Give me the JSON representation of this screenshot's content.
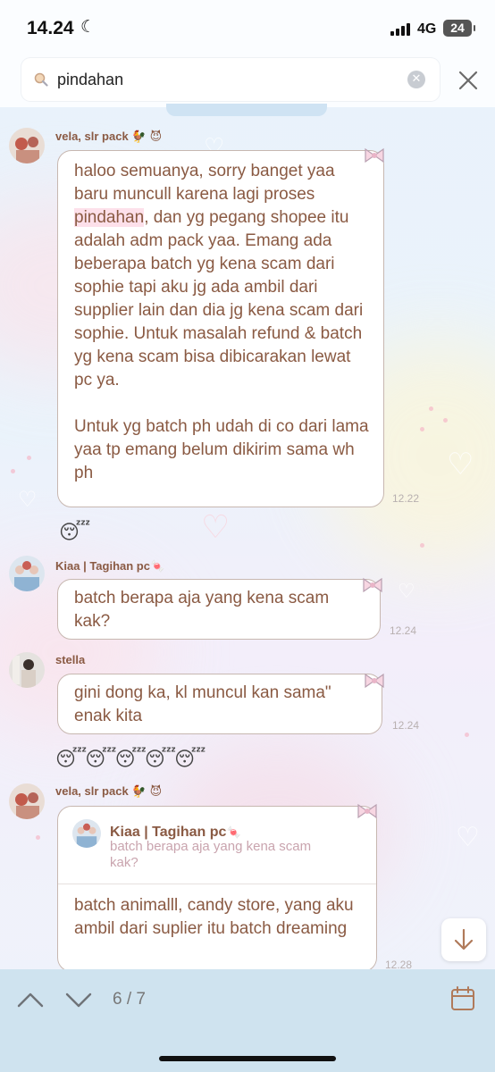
{
  "status": {
    "time": "14.24",
    "network": "4G",
    "battery": "24"
  },
  "search": {
    "query": "pindahan"
  },
  "messages": [
    {
      "sender": "vela, slr pack",
      "sender_emoji": "🐓 😈",
      "text_before": "haloo semuanya, sorry banget yaa baru muncull karena lagi proses ",
      "highlight": "pindahan",
      "text_after": ", dan yg pegang shopee itu adalah adm pack yaa. Emang ada beberapa batch yg kena scam dari sophie tapi aku jg ada ambil dari supplier lain dan dia jg kena scam dari sophie. Untuk masalah refund & batch yg kena scam bisa dibicarakan lewat pc ya.",
      "text_para2": "Untuk yg batch ph udah di co dari lama yaa tp emang belum dikirim sama wh ph",
      "time": "12.22"
    },
    {
      "sender": "Kiaa | Tagihan pc",
      "sender_emoji": "🍬",
      "text": "batch berapa aja yang kena scam kak?",
      "time": "12.24"
    },
    {
      "sender": "stella",
      "text": "gini dong ka, kl muncul kan sama\" enak kita",
      "time": "12.24"
    },
    {
      "sender": "vela, slr pack",
      "sender_emoji": "🐓 😈",
      "reply_name": "Kiaa | Tagihan pc",
      "reply_text": "batch berapa aja yang kena scam kak?",
      "text": "batch animalll, candy store, yang aku ambil dari suplier itu batch dreaming",
      "time": "12.28"
    }
  ],
  "stickers": {
    "single": "😴",
    "row": "😴😴😴😴😴"
  },
  "footer": {
    "counter": "6 / 7"
  }
}
